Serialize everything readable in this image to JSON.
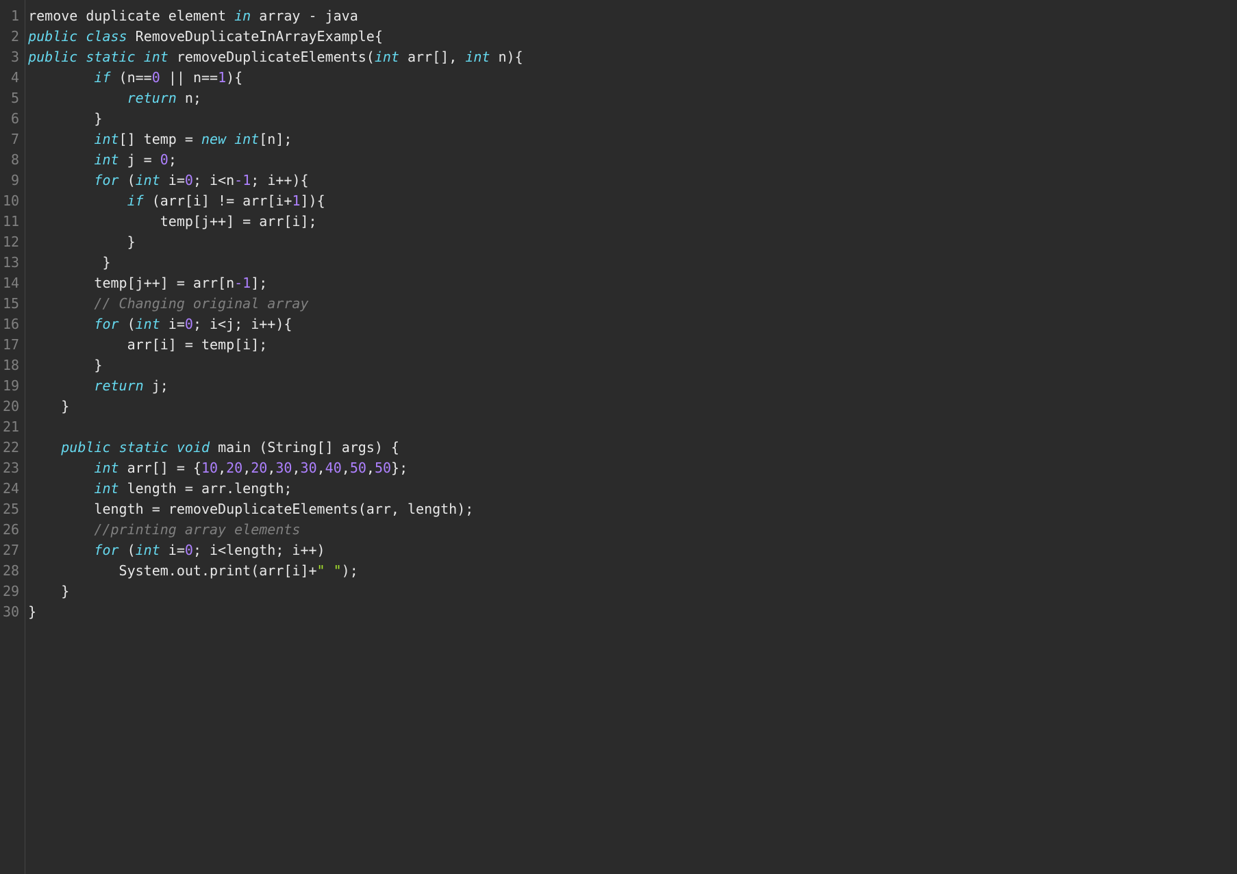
{
  "code": {
    "totalLines": 30,
    "lines": [
      {
        "n": 1,
        "tokens": [
          {
            "t": "remove duplicate element ",
            "c": "default"
          },
          {
            "t": "in",
            "c": "keyword"
          },
          {
            "t": " array - java",
            "c": "default"
          }
        ]
      },
      {
        "n": 2,
        "tokens": [
          {
            "t": "public",
            "c": "keyword"
          },
          {
            "t": " ",
            "c": "default"
          },
          {
            "t": "class",
            "c": "keyword"
          },
          {
            "t": " RemoveDuplicateInArrayExample{  ",
            "c": "default"
          }
        ]
      },
      {
        "n": 3,
        "tokens": [
          {
            "t": "public",
            "c": "keyword"
          },
          {
            "t": " ",
            "c": "default"
          },
          {
            "t": "static",
            "c": "keyword"
          },
          {
            "t": " ",
            "c": "default"
          },
          {
            "t": "int",
            "c": "type"
          },
          {
            "t": " removeDuplicateElements(",
            "c": "default"
          },
          {
            "t": "int",
            "c": "type"
          },
          {
            "t": " arr[], ",
            "c": "default"
          },
          {
            "t": "int",
            "c": "type"
          },
          {
            "t": " n){  ",
            "c": "default"
          }
        ]
      },
      {
        "n": 4,
        "tokens": [
          {
            "t": "        ",
            "c": "default"
          },
          {
            "t": "if",
            "c": "keyword"
          },
          {
            "t": " (n==",
            "c": "default"
          },
          {
            "t": "0",
            "c": "number"
          },
          {
            "t": " || n==",
            "c": "default"
          },
          {
            "t": "1",
            "c": "number"
          },
          {
            "t": "){  ",
            "c": "default"
          }
        ]
      },
      {
        "n": 5,
        "tokens": [
          {
            "t": "            ",
            "c": "default"
          },
          {
            "t": "return",
            "c": "keyword"
          },
          {
            "t": " n;  ",
            "c": "default"
          }
        ]
      },
      {
        "n": 6,
        "tokens": [
          {
            "t": "        }  ",
            "c": "default"
          }
        ]
      },
      {
        "n": 7,
        "tokens": [
          {
            "t": "        ",
            "c": "default"
          },
          {
            "t": "int",
            "c": "type"
          },
          {
            "t": "[] temp = ",
            "c": "default"
          },
          {
            "t": "new",
            "c": "new"
          },
          {
            "t": " ",
            "c": "default"
          },
          {
            "t": "int",
            "c": "type"
          },
          {
            "t": "[n];  ",
            "c": "default"
          }
        ]
      },
      {
        "n": 8,
        "tokens": [
          {
            "t": "        ",
            "c": "default"
          },
          {
            "t": "int",
            "c": "type"
          },
          {
            "t": " j = ",
            "c": "default"
          },
          {
            "t": "0",
            "c": "number"
          },
          {
            "t": ";  ",
            "c": "default"
          }
        ]
      },
      {
        "n": 9,
        "tokens": [
          {
            "t": "        ",
            "c": "default"
          },
          {
            "t": "for",
            "c": "keyword"
          },
          {
            "t": " (",
            "c": "default"
          },
          {
            "t": "int",
            "c": "type"
          },
          {
            "t": " i=",
            "c": "default"
          },
          {
            "t": "0",
            "c": "number"
          },
          {
            "t": "; i<n",
            "c": "default"
          },
          {
            "t": "-1",
            "c": "number"
          },
          {
            "t": "; i++){  ",
            "c": "default"
          }
        ]
      },
      {
        "n": 10,
        "tokens": [
          {
            "t": "            ",
            "c": "default"
          },
          {
            "t": "if",
            "c": "keyword"
          },
          {
            "t": " (arr[i] != arr[i+",
            "c": "default"
          },
          {
            "t": "1",
            "c": "number"
          },
          {
            "t": "]){  ",
            "c": "default"
          }
        ]
      },
      {
        "n": 11,
        "tokens": [
          {
            "t": "                temp[j++] = arr[i];  ",
            "c": "default"
          }
        ]
      },
      {
        "n": 12,
        "tokens": [
          {
            "t": "            }  ",
            "c": "default"
          }
        ]
      },
      {
        "n": 13,
        "tokens": [
          {
            "t": "         }  ",
            "c": "default"
          }
        ]
      },
      {
        "n": 14,
        "tokens": [
          {
            "t": "        temp[j++] = arr[n",
            "c": "default"
          },
          {
            "t": "-1",
            "c": "number"
          },
          {
            "t": "];     ",
            "c": "default"
          }
        ]
      },
      {
        "n": 15,
        "tokens": [
          {
            "t": "        ",
            "c": "default"
          },
          {
            "t": "// Changing original array  ",
            "c": "comment"
          }
        ]
      },
      {
        "n": 16,
        "tokens": [
          {
            "t": "        ",
            "c": "default"
          },
          {
            "t": "for",
            "c": "keyword"
          },
          {
            "t": " (",
            "c": "default"
          },
          {
            "t": "int",
            "c": "type"
          },
          {
            "t": " i=",
            "c": "default"
          },
          {
            "t": "0",
            "c": "number"
          },
          {
            "t": "; i<j; i++){  ",
            "c": "default"
          }
        ]
      },
      {
        "n": 17,
        "tokens": [
          {
            "t": "            arr[i] = temp[i];  ",
            "c": "default"
          }
        ]
      },
      {
        "n": 18,
        "tokens": [
          {
            "t": "        }  ",
            "c": "default"
          }
        ]
      },
      {
        "n": 19,
        "tokens": [
          {
            "t": "        ",
            "c": "default"
          },
          {
            "t": "return",
            "c": "keyword"
          },
          {
            "t": " j;  ",
            "c": "default"
          }
        ]
      },
      {
        "n": 20,
        "tokens": [
          {
            "t": "    }  ",
            "c": "default"
          }
        ]
      },
      {
        "n": 21,
        "tokens": [
          {
            "t": "       ",
            "c": "default"
          }
        ]
      },
      {
        "n": 22,
        "tokens": [
          {
            "t": "    ",
            "c": "default"
          },
          {
            "t": "public",
            "c": "keyword"
          },
          {
            "t": " ",
            "c": "default"
          },
          {
            "t": "static",
            "c": "keyword"
          },
          {
            "t": " ",
            "c": "default"
          },
          {
            "t": "void",
            "c": "type"
          },
          {
            "t": " main (String[] args) {  ",
            "c": "default"
          }
        ]
      },
      {
        "n": 23,
        "tokens": [
          {
            "t": "        ",
            "c": "default"
          },
          {
            "t": "int",
            "c": "type"
          },
          {
            "t": " arr[] = {",
            "c": "default"
          },
          {
            "t": "10",
            "c": "number"
          },
          {
            "t": ",",
            "c": "default"
          },
          {
            "t": "20",
            "c": "number"
          },
          {
            "t": ",",
            "c": "default"
          },
          {
            "t": "20",
            "c": "number"
          },
          {
            "t": ",",
            "c": "default"
          },
          {
            "t": "30",
            "c": "number"
          },
          {
            "t": ",",
            "c": "default"
          },
          {
            "t": "30",
            "c": "number"
          },
          {
            "t": ",",
            "c": "default"
          },
          {
            "t": "40",
            "c": "number"
          },
          {
            "t": ",",
            "c": "default"
          },
          {
            "t": "50",
            "c": "number"
          },
          {
            "t": ",",
            "c": "default"
          },
          {
            "t": "50",
            "c": "number"
          },
          {
            "t": "};  ",
            "c": "default"
          }
        ]
      },
      {
        "n": 24,
        "tokens": [
          {
            "t": "        ",
            "c": "default"
          },
          {
            "t": "int",
            "c": "type"
          },
          {
            "t": " length = arr.length;  ",
            "c": "default"
          }
        ]
      },
      {
        "n": 25,
        "tokens": [
          {
            "t": "        length = removeDuplicateElements(arr, length);  ",
            "c": "default"
          }
        ]
      },
      {
        "n": 26,
        "tokens": [
          {
            "t": "        ",
            "c": "default"
          },
          {
            "t": "//printing array elements  ",
            "c": "comment"
          }
        ]
      },
      {
        "n": 27,
        "tokens": [
          {
            "t": "        ",
            "c": "default"
          },
          {
            "t": "for",
            "c": "keyword"
          },
          {
            "t": " (",
            "c": "default"
          },
          {
            "t": "int",
            "c": "type"
          },
          {
            "t": " i=",
            "c": "default"
          },
          {
            "t": "0",
            "c": "number"
          },
          {
            "t": "; i<length; i++)  ",
            "c": "default"
          }
        ]
      },
      {
        "n": 28,
        "tokens": [
          {
            "t": "           System.out.print(arr[i]+",
            "c": "default"
          },
          {
            "t": "\" \"",
            "c": "string"
          },
          {
            "t": ");  ",
            "c": "default"
          }
        ]
      },
      {
        "n": 29,
        "tokens": [
          {
            "t": "    }  ",
            "c": "default"
          }
        ]
      },
      {
        "n": 30,
        "tokens": [
          {
            "t": "}  ",
            "c": "default"
          }
        ]
      }
    ]
  }
}
